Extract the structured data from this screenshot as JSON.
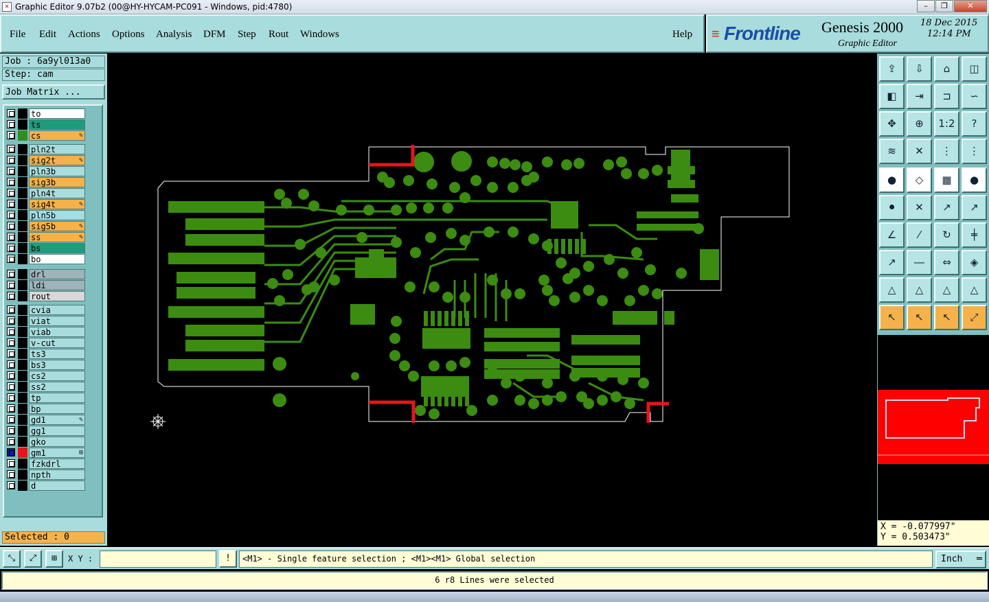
{
  "window": {
    "title": "Graphic Editor 9.07b2 (00@HY-HYCAM-PC091 - Windows, pid:4780)",
    "minimize": "–",
    "restore": "❐",
    "close": "✕"
  },
  "menu": {
    "items": [
      "File",
      "Edit",
      "Actions",
      "Options",
      "Analysis",
      "DFM",
      "Step",
      "Rout",
      "Windows"
    ],
    "help": "Help"
  },
  "brand": {
    "logo": "Frontline",
    "product": "Genesis 2000",
    "subtitle": "Graphic Editor",
    "date": "18 Dec 2015",
    "time": "12:14 PM"
  },
  "job": {
    "job_label": "Job : 6a9yl013a0",
    "step_label": "Step: cam",
    "matrix_button": "Job Matrix ..."
  },
  "layers": [
    {
      "name": "to",
      "color": "#ffffff",
      "swatch": "#000000",
      "editable": false
    },
    {
      "name": "ts",
      "color": "#1e9c7c",
      "swatch": "#000000",
      "editable": false
    },
    {
      "name": "cs",
      "color": "#f6b24a",
      "swatch": "#2e8f1e",
      "editable": true
    },
    {
      "name": "pln2t",
      "color": "#a9dcdc",
      "swatch": "#000000",
      "editable": false
    },
    {
      "name": "sig2t",
      "color": "#f6b24a",
      "swatch": "#000000",
      "editable": true
    },
    {
      "name": "pln3b",
      "color": "#a9dcdc",
      "swatch": "#000000",
      "editable": false
    },
    {
      "name": "sig3b",
      "color": "#f6b24a",
      "swatch": "#000000",
      "editable": false
    },
    {
      "name": "pln4t",
      "color": "#a9dcdc",
      "swatch": "#000000",
      "editable": false
    },
    {
      "name": "sig4t",
      "color": "#f6b24a",
      "swatch": "#000000",
      "editable": true
    },
    {
      "name": "pln5b",
      "color": "#a9dcdc",
      "swatch": "#000000",
      "editable": false
    },
    {
      "name": "sig5b",
      "color": "#f6b24a",
      "swatch": "#000000",
      "editable": true
    },
    {
      "name": "ss",
      "color": "#f6b24a",
      "swatch": "#000000",
      "editable": true
    },
    {
      "name": "bs",
      "color": "#1e9c7c",
      "swatch": "#000000",
      "editable": false
    },
    {
      "name": "bo",
      "color": "#ffffff",
      "swatch": "#000000",
      "editable": false
    },
    {
      "name": "drl",
      "color": "#9fb3b8",
      "swatch": "#000000",
      "editable": false
    },
    {
      "name": "ldi",
      "color": "#9fb3b8",
      "swatch": "#000000",
      "editable": false
    },
    {
      "name": "rout",
      "color": "#d8d8d8",
      "swatch": "#000000",
      "editable": false
    },
    {
      "name": "cvia",
      "color": "#a9dcdc",
      "swatch": "#000000",
      "editable": false
    },
    {
      "name": "viat",
      "color": "#a9dcdc",
      "swatch": "#000000",
      "editable": false
    },
    {
      "name": "viab",
      "color": "#a9dcdc",
      "swatch": "#000000",
      "editable": false
    },
    {
      "name": "v-cut",
      "color": "#a9dcdc",
      "swatch": "#000000",
      "editable": false
    },
    {
      "name": "ts3",
      "color": "#a9dcdc",
      "swatch": "#000000",
      "editable": false
    },
    {
      "name": "bs3",
      "color": "#a9dcdc",
      "swatch": "#000000",
      "editable": false
    },
    {
      "name": "cs2",
      "color": "#a9dcdc",
      "swatch": "#000000",
      "editable": false
    },
    {
      "name": "ss2",
      "color": "#a9dcdc",
      "swatch": "#000000",
      "editable": false
    },
    {
      "name": "tp",
      "color": "#a9dcdc",
      "swatch": "#000000",
      "editable": false
    },
    {
      "name": "bp",
      "color": "#a9dcdc",
      "swatch": "#000000",
      "editable": false
    },
    {
      "name": "gd1",
      "color": "#a9dcdc",
      "swatch": "#000000",
      "editable": true
    },
    {
      "name": "gg1",
      "color": "#a9dcdc",
      "swatch": "#000000",
      "editable": false
    },
    {
      "name": "gko",
      "color": "#a9dcdc",
      "swatch": "#000000",
      "editable": false
    },
    {
      "name": "gm1",
      "color": "#a9dcdc",
      "swatch": "#e8141c",
      "editable": false,
      "active": true
    },
    {
      "name": "fzkdrl",
      "color": "#a9dcdc",
      "swatch": "#000000",
      "editable": false
    },
    {
      "name": "npth",
      "color": "#a9dcdc",
      "swatch": "#000000",
      "editable": false
    },
    {
      "name": "d",
      "color": "#a9dcdc",
      "swatch": "#000000",
      "editable": false
    }
  ],
  "selected": "Selected : 0",
  "coords": {
    "x": "X = -0.077997\"",
    "y": "Y = 0.503473\""
  },
  "bottom": {
    "xy_label": "X Y :",
    "xy_value": "",
    "hint": "<M1> - Single feature selection ; <M1><M1> Global selection",
    "units": "Inch"
  },
  "status": "6 r8 Lines were selected",
  "tools": [
    "⇪",
    "⇩",
    "⌂",
    "◫",
    "◧",
    "⇥",
    "⊐",
    "∽",
    "✥",
    "⊕",
    "1:2",
    "?",
    "≋",
    "✕",
    "⋮",
    "⋮",
    "●",
    "◇",
    "▦",
    "●",
    "⚫",
    "✕",
    "↗",
    "↗",
    "∠",
    "⁄",
    "↻",
    "╪",
    "↗",
    "―",
    "⇔",
    "◈",
    "△",
    "△",
    "△",
    "△",
    "↖",
    "↖",
    "↖",
    "⤢"
  ],
  "colors": {
    "copper": "#3c8c12",
    "profile": "#ffffff",
    "highlight": "#e8141c",
    "panel": "#a9dcdc"
  }
}
